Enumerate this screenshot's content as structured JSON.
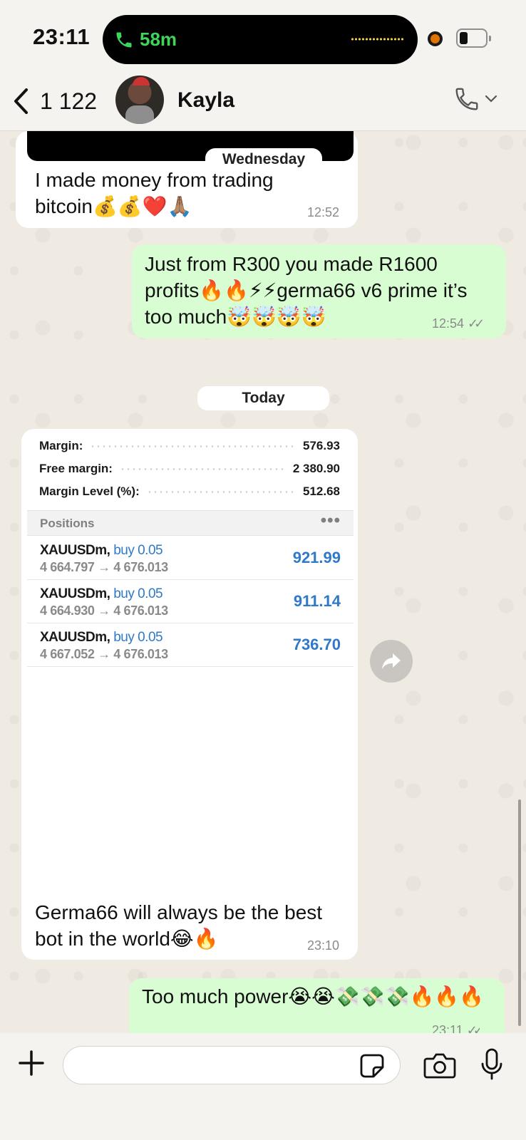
{
  "status_bar": {
    "time": "23:11",
    "call_duration": "58m"
  },
  "header": {
    "back_count": "1 122",
    "contact_name": "Kayla"
  },
  "messages": {
    "m1": {
      "text": "I made money from trading bitcoin💰💰❤️🙏🏽",
      "time": "12:52"
    },
    "day1": "Wednesday",
    "m2": {
      "text": "Just from R300 you made R1600 profits🔥🔥⚡⚡germa66 v6 prime it’s too much🤯🤯🤯🤯",
      "time": "12:54"
    },
    "day2": "Today",
    "m3": {
      "text": "Germa66 will always be the best bot in the world😂🔥",
      "time": "23:10"
    },
    "m4": {
      "text": "Too much power😭😭💸💸💸🔥🔥🔥",
      "time": "23:11"
    }
  },
  "screenshot": {
    "margin_rows": [
      {
        "label": "Margin:",
        "value": "576.93"
      },
      {
        "label": "Free margin:",
        "value": "2 380.90"
      },
      {
        "label": "Margin Level (%):",
        "value": "512.68"
      }
    ],
    "positions_title": "Positions",
    "positions_menu": "•••",
    "positions": [
      {
        "symbol": "XAUUSDm,",
        "direction": "buy 0.05",
        "prices": "4 664.797 → 4 676.013",
        "profit": "921.99"
      },
      {
        "symbol": "XAUUSDm,",
        "direction": "buy 0.05",
        "prices": "4 664.930 → 4 676.013",
        "profit": "911.14"
      },
      {
        "symbol": "XAUUSDm,",
        "direction": "buy 0.05",
        "prices": "4 667.052 → 4 676.013",
        "profit": "736.70"
      }
    ]
  },
  "composer": {
    "placeholder": ""
  },
  "colors": {
    "outgoing_bubble": "#d9fdd3",
    "incoming_bubble": "#ffffff",
    "profit_blue": "#2f79c8",
    "call_green": "#3ed65a"
  },
  "icons": [
    "phone-icon",
    "back-chevron-icon",
    "phone-call-icon",
    "chevron-down-icon",
    "forward-icon",
    "plus-icon",
    "sticker-icon",
    "camera-icon",
    "microphone-icon"
  ]
}
